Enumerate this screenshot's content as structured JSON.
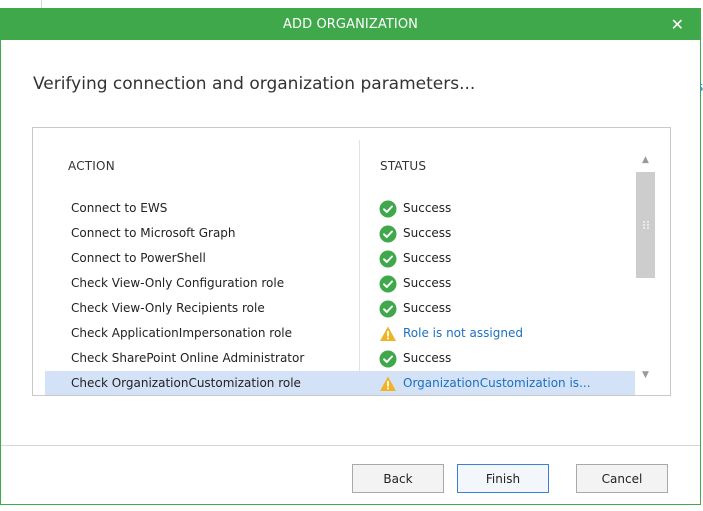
{
  "dialog": {
    "title": "ADD ORGANIZATION",
    "close_label": "✕",
    "heading": "Verifying connection and organization parameters..."
  },
  "table": {
    "columns": [
      "ACTION",
      "STATUS"
    ],
    "rows": [
      {
        "action": "Connect to EWS",
        "status": "Success",
        "type": "success"
      },
      {
        "action": "Connect to Microsoft Graph",
        "status": "Success",
        "type": "success"
      },
      {
        "action": "Connect to PowerShell",
        "status": "Success",
        "type": "success"
      },
      {
        "action": "Check View-Only Configuration role",
        "status": "Success",
        "type": "success"
      },
      {
        "action": "Check View-Only Recipients role",
        "status": "Success",
        "type": "success"
      },
      {
        "action": "Check ApplicationImpersonation role",
        "status": "Role is not assigned",
        "type": "warning"
      },
      {
        "action": "Check SharePoint Online Administrator",
        "status": "Success",
        "type": "success"
      },
      {
        "action": "Check OrganizationCustomization role",
        "status": "OrganizationCustomization is...",
        "type": "warning",
        "selected": true
      }
    ]
  },
  "buttons": {
    "back": "Back",
    "finish": "Finish",
    "cancel": "Cancel"
  },
  "background": {
    "link_fragment": "s"
  },
  "colors": {
    "accent": "#3ea84a",
    "success": "#3ea84a",
    "warning": "#f0b323",
    "link": "#1e6fbf",
    "selected_row": "#d3e2f7"
  },
  "icons": {
    "success": "check-circle-icon",
    "warning": "warning-triangle-icon"
  }
}
